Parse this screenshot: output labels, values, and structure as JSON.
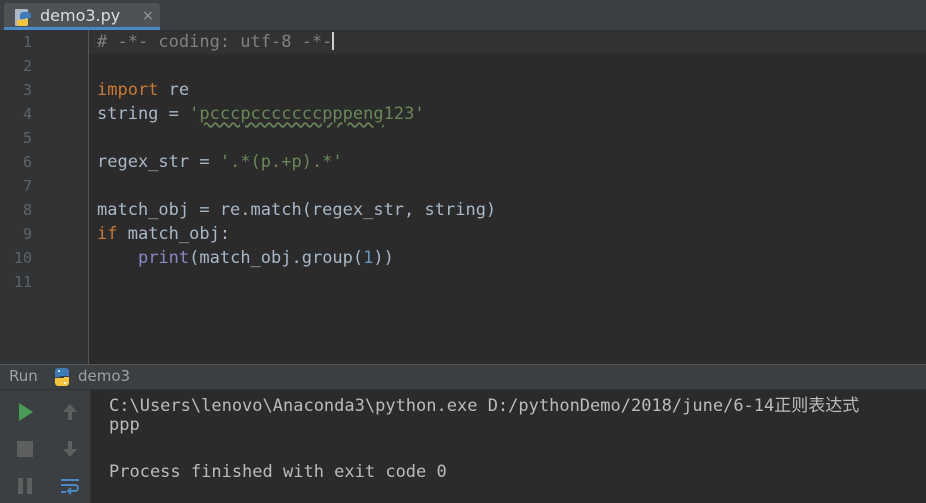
{
  "editor": {
    "tab": {
      "filename": "demo3.py",
      "close_glyph": "×"
    },
    "line_numbers": [
      "1",
      "2",
      "3",
      "4",
      "5",
      "6",
      "7",
      "8",
      "9",
      "10",
      "11"
    ],
    "code": {
      "l1_comment": "# -*- coding: utf-8 -*-",
      "l3_kw": "import",
      "l3_rest": " re",
      "l4_var": "string = ",
      "l4_quote_open": "'",
      "l4_str_body": "pcccpcccccccpppeng",
      "l4_str_tail": "123",
      "l4_quote_close": "'",
      "l6_var": "regex_str = ",
      "l6_str": "'.*(p.+p).*'",
      "l8_code": "match_obj = re.match(regex_str, string)",
      "l9_kw": "if",
      "l9_rest": " match_obj:",
      "l10_indent": "    ",
      "l10_fn": "print",
      "l10_mid": "(match_obj.group(",
      "l10_num": "1",
      "l10_end": "))"
    }
  },
  "run_panel": {
    "title": "Run",
    "config_name": "demo3",
    "console": {
      "line1": "C:\\Users\\lenovo\\Anaconda3\\python.exe D:/pythonDemo/2018/june/6-14正则表达式",
      "line2": "ppp",
      "line3": "",
      "line4": "Process finished with exit code 0"
    }
  },
  "colors": {
    "keyword": "#cc7832",
    "string": "#6a8759",
    "number": "#6897bb",
    "comment": "#808080",
    "builtin": "#8888c6",
    "run_green": "#499c54"
  }
}
